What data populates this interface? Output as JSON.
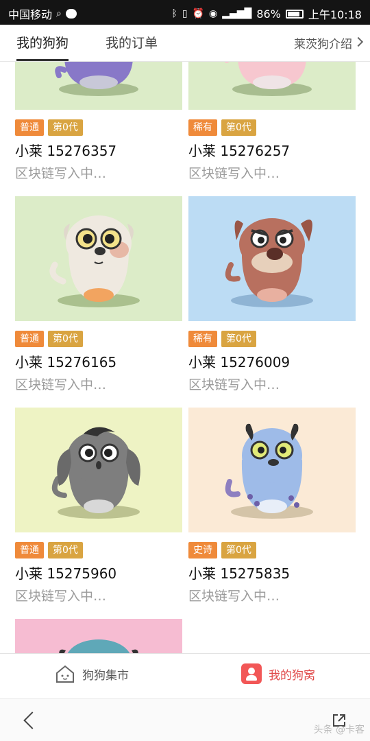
{
  "status_bar": {
    "carrier": "中国移动",
    "battery": "86%",
    "time": "上午10:18"
  },
  "top_nav": {
    "tabs": [
      {
        "label": "我的狗狗"
      },
      {
        "label": "我的订单"
      }
    ],
    "intro_link": "莱茨狗介绍"
  },
  "dogs": [
    {
      "rarity": "普通",
      "generation": "第0代",
      "name": "小莱 15276357",
      "status": "区块链写入中…",
      "bg": "#dcecc8"
    },
    {
      "rarity": "稀有",
      "generation": "第0代",
      "name": "小莱 15276257",
      "status": "区块链写入中…",
      "bg": "#dcecc8"
    },
    {
      "rarity": "普通",
      "generation": "第0代",
      "name": "小莱 15276165",
      "status": "区块链写入中…",
      "bg": "#dcecc8"
    },
    {
      "rarity": "稀有",
      "generation": "第0代",
      "name": "小莱 15276009",
      "status": "区块链写入中…",
      "bg": "#bcdcf4"
    },
    {
      "rarity": "普通",
      "generation": "第0代",
      "name": "小莱 15275960",
      "status": "区块链写入中…",
      "bg": "#eef3c4"
    },
    {
      "rarity": "史诗",
      "generation": "第0代",
      "name": "小莱 15275835",
      "status": "区块链写入中…",
      "bg": "#fbead6"
    },
    {
      "bg": "#f6bcd2"
    }
  ],
  "bottom_bar": {
    "market": "狗狗集市",
    "kennel": "我的狗窝"
  },
  "watermark": "头条 @卡客"
}
